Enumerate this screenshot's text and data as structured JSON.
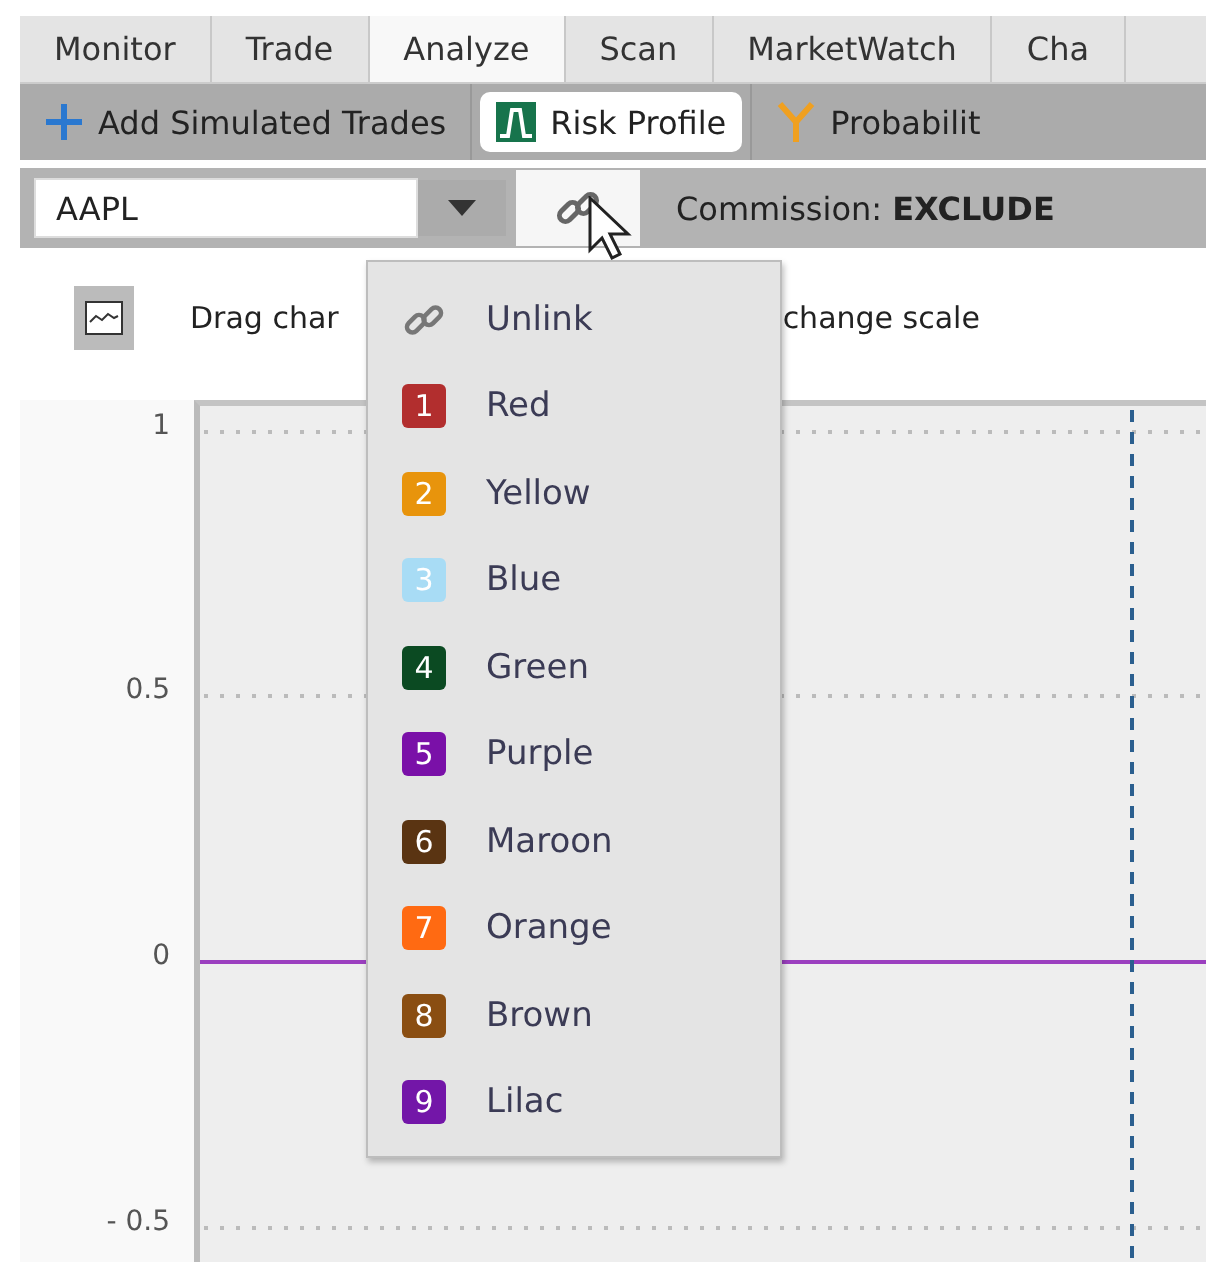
{
  "tabs": [
    {
      "label": "Monitor",
      "selected": false
    },
    {
      "label": "Trade",
      "selected": false
    },
    {
      "label": "Analyze",
      "selected": true
    },
    {
      "label": "Scan",
      "selected": false
    },
    {
      "label": "MarketWatch",
      "selected": false
    },
    {
      "label": "Cha",
      "selected": false
    }
  ],
  "toolbar": [
    {
      "kind": "add",
      "label": "Add Simulated Trades",
      "selected": false
    },
    {
      "kind": "risk",
      "label": "Risk Profile",
      "selected": true
    },
    {
      "kind": "probability",
      "label": "Probabilit",
      "selected": false
    }
  ],
  "symbol_field": {
    "value": "AAPL"
  },
  "commission": {
    "label": "Commission:",
    "value": "EXCLUDE"
  },
  "hint": [
    "Drag char",
    "change scale"
  ],
  "chart": {
    "y_labels": [
      "1",
      "0.5",
      "0",
      "- 0.5"
    ]
  },
  "link_menu": [
    {
      "kind": "unlink",
      "label": "Unlink"
    },
    {
      "kind": "color",
      "number": "1",
      "label": "Red",
      "color": "#b22e2e"
    },
    {
      "kind": "color",
      "number": "2",
      "label": "Yellow",
      "color": "#e8940c"
    },
    {
      "kind": "color",
      "number": "3",
      "label": "Blue",
      "color": "#a8dcf5"
    },
    {
      "kind": "color",
      "number": "4",
      "label": "Green",
      "color": "#0b4a22"
    },
    {
      "kind": "color",
      "number": "5",
      "label": "Purple",
      "color": "#7a10a8"
    },
    {
      "kind": "color",
      "number": "6",
      "label": "Maroon",
      "color": "#5a3412"
    },
    {
      "kind": "color",
      "number": "7",
      "label": "Orange",
      "color": "#ff6a12"
    },
    {
      "kind": "color",
      "number": "8",
      "label": "Brown",
      "color": "#8a4e12"
    },
    {
      "kind": "color",
      "number": "9",
      "label": "Lilac",
      "color": "#7316a8"
    }
  ]
}
